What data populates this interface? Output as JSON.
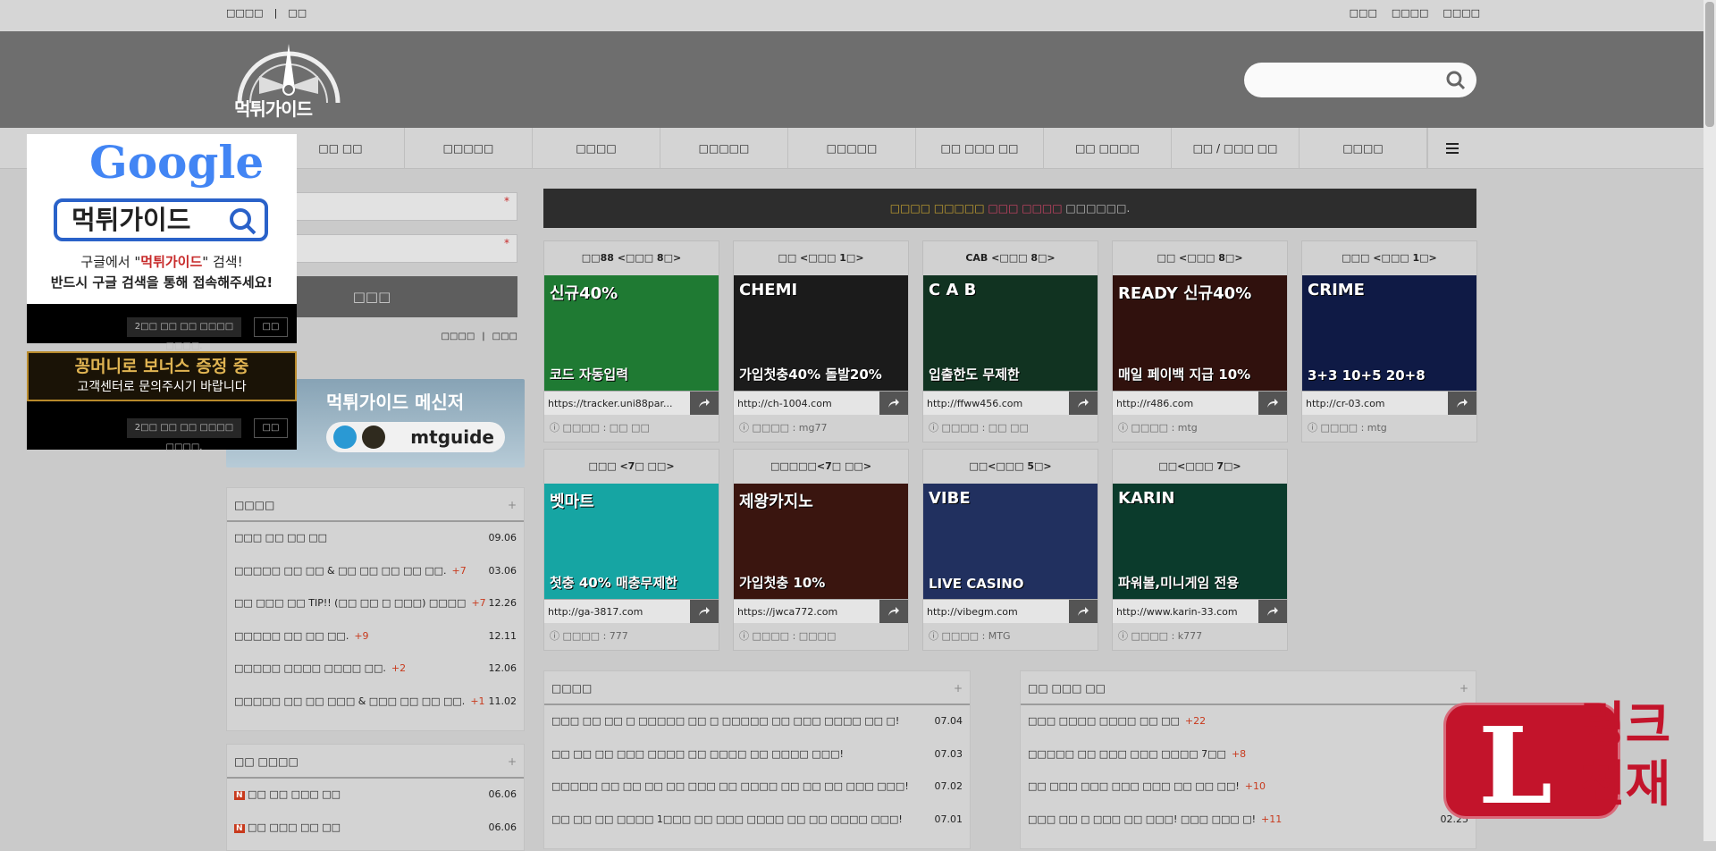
{
  "topbar": {
    "left": [
      "□□□□",
      "□□"
    ],
    "right": [
      "□□□",
      "□□□□",
      "□□□□"
    ]
  },
  "logo": {
    "text": "먹튀가이드"
  },
  "search": {
    "placeholder": ""
  },
  "nav": {
    "items": [
      "□□ □□",
      "□□□□□",
      "□□□□",
      "□□□□□",
      "□□□□□",
      "□□ □□□ □□",
      "□□ □□□□",
      "□□ / □□□ □□",
      "□□□□"
    ]
  },
  "login": {
    "id_placeholder": "□",
    "pw_placeholder": "□",
    "star": "*",
    "button": "□□□",
    "links": [
      "□□□□",
      "□□□"
    ],
    "save": "□"
  },
  "messenger": {
    "title": "먹튀가이드 메신저",
    "id": "mtguide"
  },
  "notice": {
    "pre": "□□□□ □□□□□",
    "hl": "□□□ □□□□",
    "post": "□□□□□□."
  },
  "cards": [
    {
      "title": "□□88 <□□□ 8□>",
      "headline": "신규40%",
      "sub": "코드 자동입력",
      "url": "https://tracker.uni88par...",
      "by": "□□□□ : □□ □□",
      "bg": "#1f7a33"
    },
    {
      "title": "□□ <□□□ 1□>",
      "headline": "CHEMI",
      "sub": "가입첫충40% 돌발20%",
      "url": "http://ch-1004.com",
      "by": "□□□□ : mg77",
      "bg": "#1b1b1b"
    },
    {
      "title": "CAB <□□□ 8□>",
      "headline": "C A B",
      "sub": "입출한도 무제한",
      "url": "http://ffww456.com",
      "by": "□□□□ : □□ □□",
      "bg": "#113321"
    },
    {
      "title": "□□ <□□□ 8□>",
      "headline": "READY 신규40%",
      "sub": "매일 페이백 지급 10%",
      "url": "http://r486.com",
      "by": "□□□□ : mtg",
      "bg": "#30110d"
    },
    {
      "title": "□□□ <□□□ 1□>",
      "headline": "CRIME",
      "sub": "3+3 10+5 20+8",
      "url": "http://cr-03.com",
      "by": "□□□□ : mtg",
      "bg": "#0f1a45"
    },
    {
      "title": "□□□ <7□ □□>",
      "headline": "벳마트",
      "sub": "첫충 40% 매충무제한",
      "url": "http://ga-3817.com",
      "by": "□□□□ : 777",
      "bg": "#16a5a3"
    },
    {
      "title": "□□□□□<7□ □□>",
      "headline": "제왕카지노",
      "sub": "가입첫충 10%",
      "url": "https://jwca772.com",
      "by": "□□□□ : □□□□",
      "bg": "#3a150f"
    },
    {
      "title": "□□<□□□ 5□>",
      "headline": "VIBE",
      "sub": "LIVE CASINO",
      "url": "http://vibegm.com",
      "by": "□□□□ : MTG",
      "bg": "#21305f"
    },
    {
      "title": "□□<□□□ 7□>",
      "headline": "KARIN",
      "sub": "파워볼,미니게임 전용",
      "url": "http://www.karin-33.com",
      "by": "□□□□ : k777",
      "bg": "#0b3b2c"
    }
  ],
  "left_box1": {
    "title": "□□□□",
    "rows": [
      {
        "t": "□□□ □□ □□ □□",
        "c": "",
        "d": "09.06"
      },
      {
        "t": "□□□□□ □□ □□ & □□ □□ □□ □□ □□.",
        "c": "+7",
        "d": "03.06"
      },
      {
        "t": "□□ □□□ □□ TIP!! (□□ □□ □ □□□) □□□□",
        "c": "+7",
        "d": "12.26"
      },
      {
        "t": "□□□□□ □□ □□ □□.",
        "c": "+9",
        "d": "12.11"
      },
      {
        "t": "□□□□□ □□□□ □□□□ □□.",
        "c": "+2",
        "d": "12.06"
      },
      {
        "t": "□□□□□ □□ □□ □□□ & □□□ □□ □□ □□.",
        "c": "+1",
        "d": "11.02"
      }
    ]
  },
  "left_box2": {
    "title": "□□ □□□□",
    "rows": [
      {
        "t": "□□ □□ □□□ □□",
        "d": "06.06"
      },
      {
        "t": "□□ □□□ □□ □□",
        "d": "06.06"
      }
    ]
  },
  "mid_box": {
    "title": "□□□□",
    "rows": [
      {
        "t": "□□□ □□ □□ □ □□□□□ □□ □ □□□□□ □□ □□□ □□□□ □□ □!",
        "d": "07.04"
      },
      {
        "t": "□□ □□ □□ □□□ □□□□ □□ □□□□ □□ □□□□ □□□!",
        "d": "07.03"
      },
      {
        "t": "□□□□□ □□ □□ □□ □□ □□□ □□ □□□□ □□ □□ □□ □□□ □□□!",
        "d": "07.02"
      },
      {
        "t": "□□ □□ □□ □□□□ 1□□□ □□ □□□ □□□□ □□ □□ □□□□ □□□!",
        "d": "07.01"
      }
    ]
  },
  "right_box": {
    "title": "□□ □□□ □□",
    "rows": [
      {
        "t": "□□□ □□□□ □□□□ □□ □□",
        "c": "+22",
        "d": "0"
      },
      {
        "t": "□□□□□ □□ □□□ □□□ □□□□ 7□□",
        "c": "+8",
        "d": "0"
      },
      {
        "t": "□□ □□□ □□□ □□□ □□□ □□ □□ □□!",
        "c": "+10",
        "d": "0"
      },
      {
        "t": "□□□ □□ □ □□□ □□ □□□! □□□ □□□ □!",
        "c": "+11",
        "d": "02.25"
      }
    ]
  },
  "popup1": {
    "brand": "Google",
    "search_text": "먹튀가이드",
    "line1a": "구글에서 \"",
    "line1b": "먹튀가이드",
    "line1c": "\" 검색!",
    "line2": "반드시 구글 검색을 통해 접속해주세요!",
    "hide": "2□□ □□ □□ □□□□ □□□□.",
    "close": "□□"
  },
  "popup2": {
    "line1": "꽁머니로 보너스 증정 중",
    "line2": "고객센터로 문의주시기 바랍니다",
    "hide": "2□□ □□ □□ □□□□ □□□□.",
    "close": "□□"
  },
  "watermark": {
    "letter": "L",
    "text": "링크천재"
  }
}
